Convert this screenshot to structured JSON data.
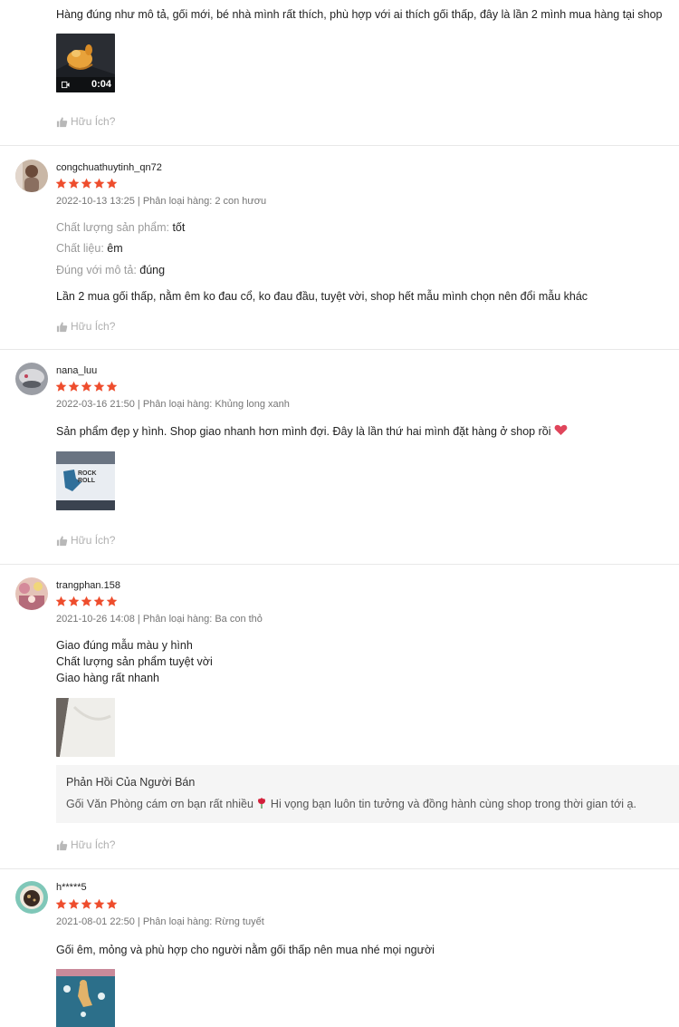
{
  "helpful_label": "Hữu Ích?",
  "colors": {
    "star": "#ee4d2d",
    "muted": "#757575",
    "reply_bg": "#f5f5f5"
  },
  "reviews": [
    {
      "text": "Hàng đúng như mô tả, gối mới, bé nhà mình rất thích, phù hợp với ai thích gối thấp, đây là lần 2 mình mua hàng tại shop",
      "media": [
        {
          "type": "video",
          "duration": "0:04"
        }
      ]
    },
    {
      "username": "congchuathuytinh_qn72",
      "rating": 5,
      "meta": "2022-10-13 13:25 | Phân loại hàng: 2 con hươu",
      "attributes": [
        {
          "label": "Chất lượng sản phẩm:",
          "value": "tốt"
        },
        {
          "label": "Chất liệu:",
          "value": "êm"
        },
        {
          "label": "Đúng với mô tả:",
          "value": "đúng"
        }
      ],
      "text": "Lần 2 mua gối thấp, nằm êm ko đau cổ, ko đau đầu, tuyệt vời,  shop hết mẫu mình chọn nên đổi mẫu khác"
    },
    {
      "username": "nana_luu",
      "rating": 5,
      "meta": "2022-03-16 21:50 | Phân loại hàng: Khủng long xanh",
      "text": "Sản phẩm đẹp y hình. Shop giao nhanh hơn mình đợi. Đây là lần thứ hai mình đặt hàng ở shop rồi",
      "media_text": "ROCK\nROLL"
    },
    {
      "username": "trangphan.158",
      "rating": 5,
      "meta": "2021-10-26 14:08 | Phân loại hàng: Ba con thỏ",
      "text": "Giao đúng mẫu màu y hình\nChất lượng sản phẩm tuyệt vời\nGiao hàng rất nhanh",
      "reply": {
        "title": "Phản Hồi Của Người Bán",
        "body_a": "Gối Văn Phòng cám ơn bạn rất nhiều",
        "body_b": "Hi vọng bạn luôn tin tưởng và đồng hành cùng shop trong thời gian tới ạ."
      }
    },
    {
      "username": "h*****5",
      "rating": 5,
      "meta": "2021-08-01 22:50 | Phân loại hàng: Rừng tuyết",
      "text": "Gối êm, mỏng và phù hợp cho người nằm gối thấp nên mua nhé mọi người"
    }
  ]
}
